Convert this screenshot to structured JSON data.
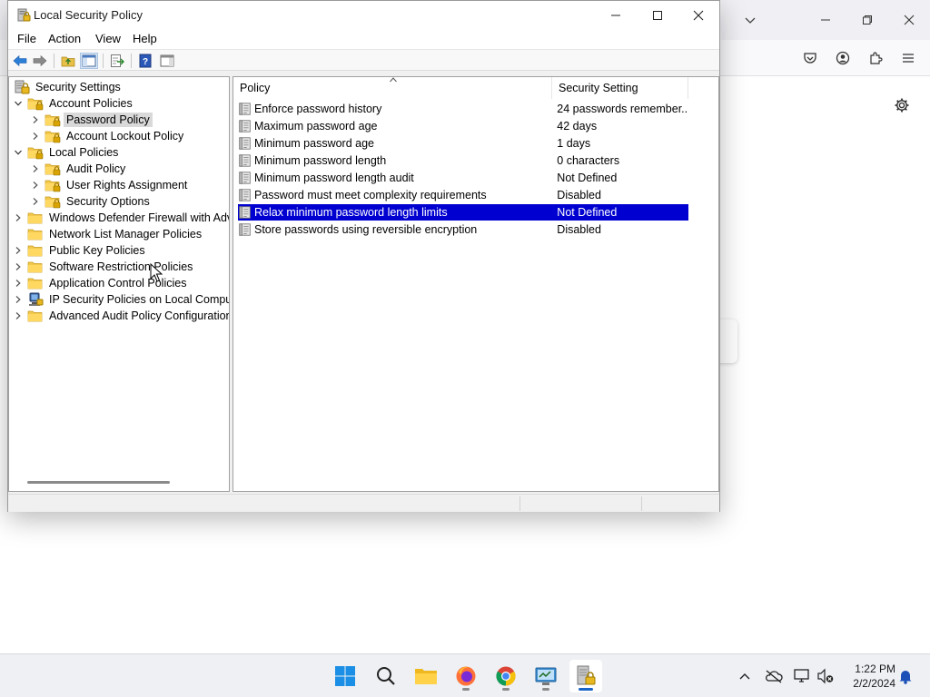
{
  "window": {
    "title": "Local Security Policy",
    "menu": [
      "File",
      "Action",
      "View",
      "Help"
    ]
  },
  "tree": {
    "items": [
      {
        "label": "Security Settings",
        "level": 0,
        "expander": "none",
        "icon": "security-settings-icon",
        "selected": false
      },
      {
        "label": "Account Policies",
        "level": 1,
        "expander": "expanded",
        "icon": "folder-lock-icon",
        "selected": false
      },
      {
        "label": "Password Policy",
        "level": 2,
        "expander": "collapsed",
        "icon": "folder-lock-icon",
        "selected": true
      },
      {
        "label": "Account Lockout Policy",
        "level": 2,
        "expander": "collapsed",
        "icon": "folder-lock-icon",
        "selected": false
      },
      {
        "label": "Local Policies",
        "level": 1,
        "expander": "expanded",
        "icon": "folder-lock-icon",
        "selected": false
      },
      {
        "label": "Audit Policy",
        "level": 2,
        "expander": "collapsed",
        "icon": "folder-lock-icon",
        "selected": false
      },
      {
        "label": "User Rights Assignment",
        "level": 2,
        "expander": "collapsed",
        "icon": "folder-lock-icon",
        "selected": false
      },
      {
        "label": "Security Options",
        "level": 2,
        "expander": "collapsed",
        "icon": "folder-lock-icon",
        "selected": false
      },
      {
        "label": "Windows Defender Firewall with Adva",
        "level": 1,
        "expander": "collapsed",
        "icon": "folder-icon",
        "selected": false
      },
      {
        "label": "Network List Manager Policies",
        "level": 1,
        "expander": "none",
        "icon": "folder-icon",
        "selected": false
      },
      {
        "label": "Public Key Policies",
        "level": 1,
        "expander": "collapsed",
        "icon": "folder-icon",
        "selected": false
      },
      {
        "label": "Software Restriction Policies",
        "level": 1,
        "expander": "collapsed",
        "icon": "folder-icon",
        "selected": false
      },
      {
        "label": "Application Control Policies",
        "level": 1,
        "expander": "collapsed",
        "icon": "folder-icon",
        "selected": false
      },
      {
        "label": "IP Security Policies on Local Compute",
        "level": 1,
        "expander": "collapsed",
        "icon": "ip-security-icon",
        "selected": false
      },
      {
        "label": "Advanced Audit Policy Configuration",
        "level": 1,
        "expander": "collapsed",
        "icon": "folder-icon",
        "selected": false
      }
    ]
  },
  "list": {
    "columns": [
      "Policy",
      "Security Setting"
    ],
    "rows": [
      {
        "policy": "Enforce password history",
        "setting": "24 passwords remember...",
        "selected": false
      },
      {
        "policy": "Maximum password age",
        "setting": "42 days",
        "selected": false
      },
      {
        "policy": "Minimum password age",
        "setting": "1 days",
        "selected": false
      },
      {
        "policy": "Minimum password length",
        "setting": "0 characters",
        "selected": false
      },
      {
        "policy": "Minimum password length audit",
        "setting": "Not Defined",
        "selected": false
      },
      {
        "policy": "Password must meet complexity requirements",
        "setting": "Disabled",
        "selected": false
      },
      {
        "policy": "Relax minimum password length limits",
        "setting": "Not Defined",
        "selected": true
      },
      {
        "policy": "Store passwords using reversible encryption",
        "setting": "Disabled",
        "selected": false
      }
    ]
  },
  "taskbar": {
    "apps": [
      "windows-start-icon",
      "search-icon",
      "file-explorer-icon",
      "firefox-icon",
      "chrome-icon",
      "control-panel-icon",
      "local-security-policy-icon"
    ],
    "time": "1:22 PM",
    "date": "2/2/2024"
  },
  "colors": {
    "selection": "#0000d0",
    "tree_selection": "#d9d9d9",
    "accent": "#1a64c8"
  }
}
